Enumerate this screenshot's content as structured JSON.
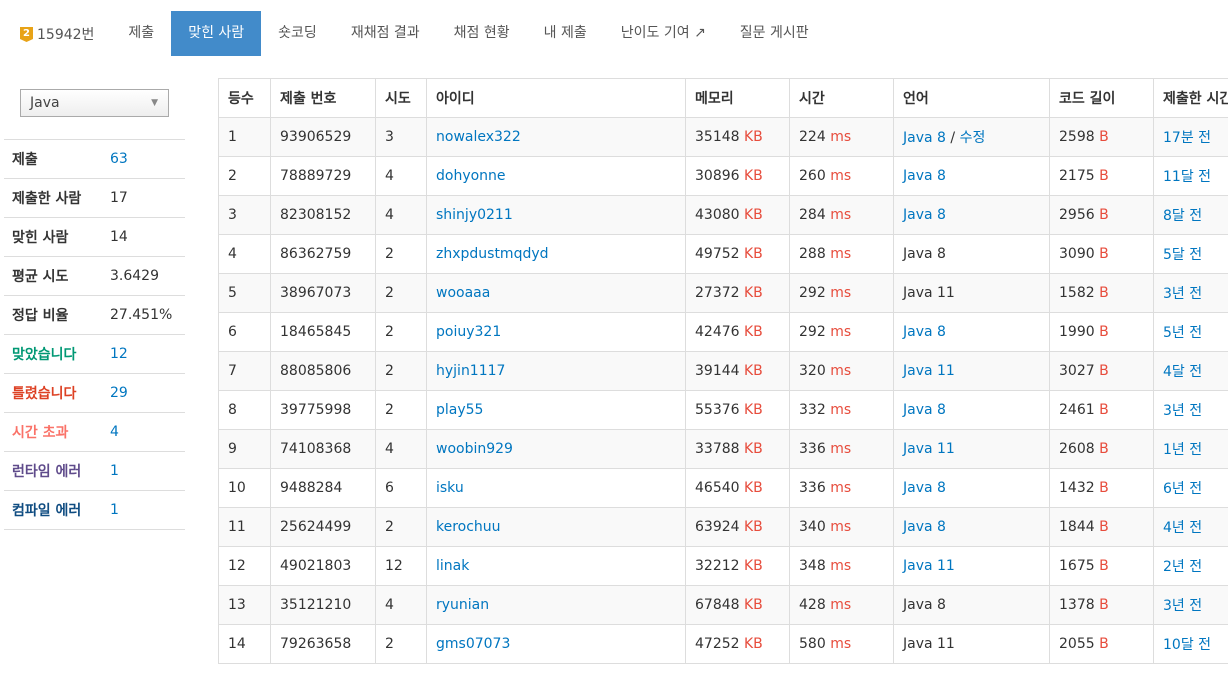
{
  "nav": {
    "problem_badge": "2",
    "problem": "15942번",
    "tabs": [
      "제출",
      "맞힌 사람",
      "숏코딩",
      "재채점 결과",
      "채점 현황",
      "내 제출",
      "난이도 기여",
      "질문 게시판"
    ],
    "active_tab": 1,
    "external_icon": "external-link-icon"
  },
  "filter": {
    "language": "Java"
  },
  "stats": [
    {
      "label": "제출",
      "value": "63",
      "color": "#333",
      "link": true
    },
    {
      "label": "제출한 사람",
      "value": "17",
      "color": "#333",
      "link": false
    },
    {
      "label": "맞힌 사람",
      "value": "14",
      "color": "#333",
      "link": false
    },
    {
      "label": "평균 시도",
      "value": "3.6429",
      "color": "#333",
      "link": false
    },
    {
      "label": "정답 비율",
      "value": "27.451%",
      "color": "#333",
      "link": false
    },
    {
      "label": "맞았습니다",
      "value": "12",
      "color": "#009874",
      "link": true
    },
    {
      "label": "틀렸습니다",
      "value": "29",
      "color": "#dd4124",
      "link": true
    },
    {
      "label": "시간 초과",
      "value": "4",
      "color": "#fa7268",
      "link": true
    },
    {
      "label": "런타임 에러",
      "value": "1",
      "color": "#5f4b8b",
      "link": true
    },
    {
      "label": "컴파일 에러",
      "value": "1",
      "color": "#0f4c81",
      "link": true
    }
  ],
  "table": {
    "headers": [
      "등수",
      "제출 번호",
      "시도",
      "아이디",
      "메모리",
      "시간",
      "언어",
      "코드 길이",
      "제출한 시간"
    ],
    "units": {
      "memory": "KB",
      "time": "ms",
      "code": "B"
    },
    "edit_label": "수정",
    "rows": [
      {
        "rank": "1",
        "sub": "93906529",
        "try": "3",
        "id": "nowalex322",
        "mem": "35148",
        "time": "224",
        "lang": "Java 8",
        "lang_link": true,
        "edit": true,
        "code": "2598",
        "when": "17분 전"
      },
      {
        "rank": "2",
        "sub": "78889729",
        "try": "4",
        "id": "dohyonne",
        "mem": "30896",
        "time": "260",
        "lang": "Java 8",
        "lang_link": true,
        "edit": false,
        "code": "2175",
        "when": "11달 전"
      },
      {
        "rank": "3",
        "sub": "82308152",
        "try": "4",
        "id": "shinjy0211",
        "mem": "43080",
        "time": "284",
        "lang": "Java 8",
        "lang_link": true,
        "edit": false,
        "code": "2956",
        "when": "8달 전"
      },
      {
        "rank": "4",
        "sub": "86362759",
        "try": "2",
        "id": "zhxpdustmqdyd",
        "mem": "49752",
        "time": "288",
        "lang": "Java 8",
        "lang_link": false,
        "edit": false,
        "code": "3090",
        "when": "5달 전"
      },
      {
        "rank": "5",
        "sub": "38967073",
        "try": "2",
        "id": "wooaaa",
        "mem": "27372",
        "time": "292",
        "lang": "Java 11",
        "lang_link": false,
        "edit": false,
        "code": "1582",
        "when": "3년 전"
      },
      {
        "rank": "6",
        "sub": "18465845",
        "try": "2",
        "id": "poiuy321",
        "mem": "42476",
        "time": "292",
        "lang": "Java 8",
        "lang_link": true,
        "edit": false,
        "code": "1990",
        "when": "5년 전"
      },
      {
        "rank": "7",
        "sub": "88085806",
        "try": "2",
        "id": "hyjin1117",
        "mem": "39144",
        "time": "320",
        "lang": "Java 11",
        "lang_link": true,
        "edit": false,
        "code": "3027",
        "when": "4달 전"
      },
      {
        "rank": "8",
        "sub": "39775998",
        "try": "2",
        "id": "play55",
        "mem": "55376",
        "time": "332",
        "lang": "Java 8",
        "lang_link": true,
        "edit": false,
        "code": "2461",
        "when": "3년 전"
      },
      {
        "rank": "9",
        "sub": "74108368",
        "try": "4",
        "id": "woobin929",
        "mem": "33788",
        "time": "336",
        "lang": "Java 11",
        "lang_link": true,
        "edit": false,
        "code": "2608",
        "when": "1년 전"
      },
      {
        "rank": "10",
        "sub": "9488284",
        "try": "6",
        "id": "isku",
        "mem": "46540",
        "time": "336",
        "lang": "Java 8",
        "lang_link": true,
        "edit": false,
        "code": "1432",
        "when": "6년 전"
      },
      {
        "rank": "11",
        "sub": "25624499",
        "try": "2",
        "id": "kerochuu",
        "mem": "63924",
        "time": "340",
        "lang": "Java 8",
        "lang_link": true,
        "edit": false,
        "code": "1844",
        "when": "4년 전"
      },
      {
        "rank": "12",
        "sub": "49021803",
        "try": "12",
        "id": "linak",
        "mem": "32212",
        "time": "348",
        "lang": "Java 11",
        "lang_link": true,
        "edit": false,
        "code": "1675",
        "when": "2년 전"
      },
      {
        "rank": "13",
        "sub": "35121210",
        "try": "4",
        "id": "ryunian",
        "mem": "67848",
        "time": "428",
        "lang": "Java 8",
        "lang_link": false,
        "edit": false,
        "code": "1378",
        "when": "3년 전"
      },
      {
        "rank": "14",
        "sub": "79263658",
        "try": "2",
        "id": "gms07073",
        "mem": "47252",
        "time": "580",
        "lang": "Java 11",
        "lang_link": false,
        "edit": false,
        "code": "2055",
        "when": "10달 전"
      }
    ]
  }
}
